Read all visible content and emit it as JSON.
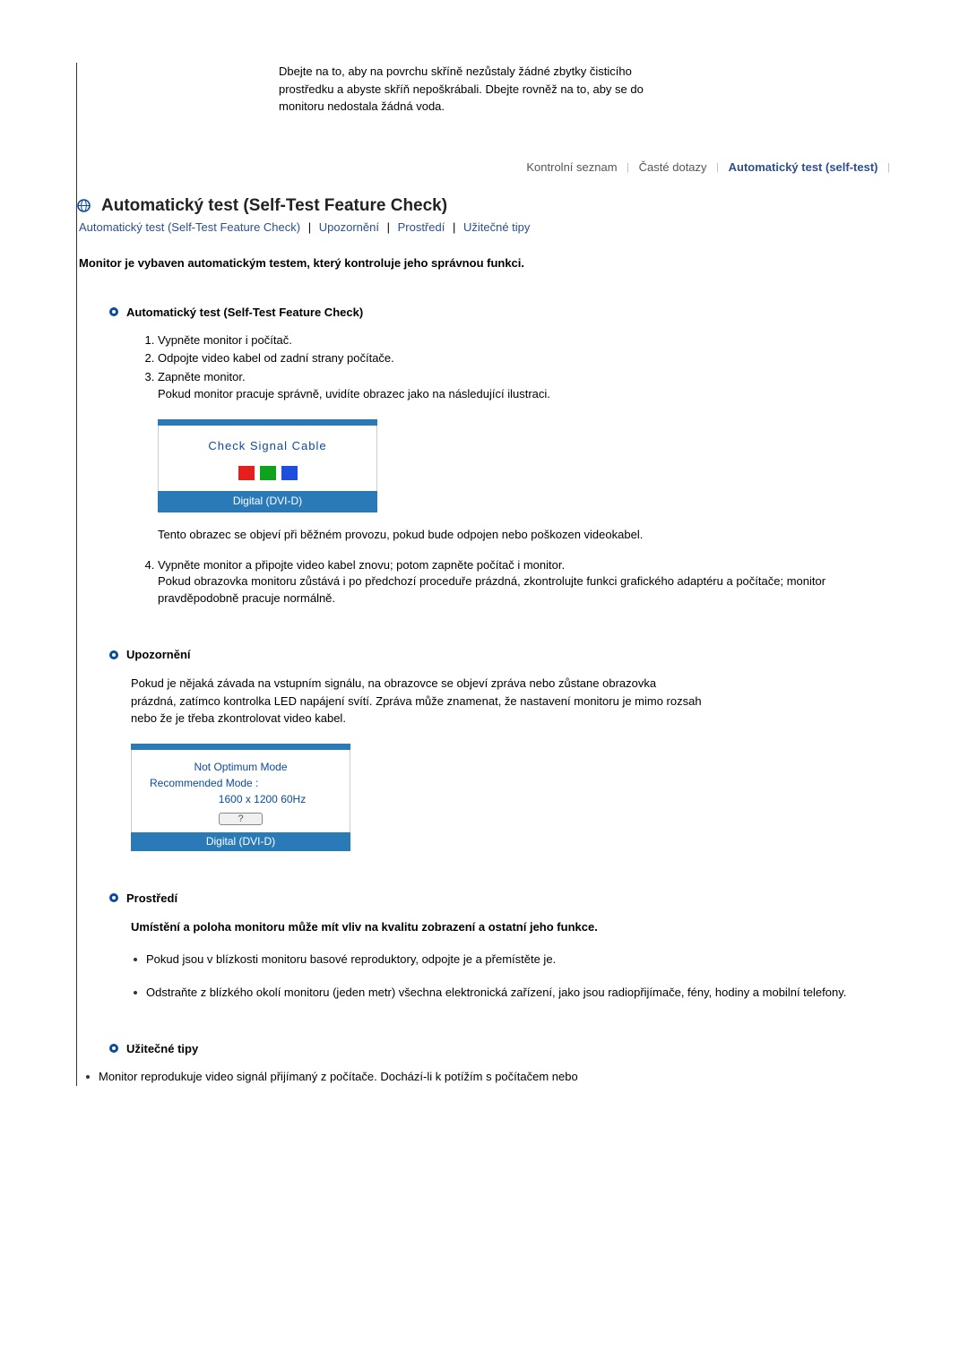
{
  "top_text": "Dbejte na to, aby na povrchu skříně nezůstaly žádné zbytky čisticího prostředku a abyste skříň nepoškrábali. Dbejte rovněž na to, aby se do monitoru nedostala žádná voda.",
  "tabs": {
    "items": [
      "Kontrolní seznam",
      "Časté dotazy",
      "Automatický test (self-test)"
    ],
    "active_index": 2
  },
  "heading": "Automatický test (Self-Test Feature Check)",
  "links": [
    "Automatický test (Self-Test Feature Check)",
    "Upozornění",
    "Prostředí",
    "Užitečné tipy"
  ],
  "intro": "Monitor je vybaven automatickým testem, který kontroluje jeho správnou funkci.",
  "section1": {
    "title": "Automatický test (Self-Test Feature Check)",
    "steps": {
      "s1": "Vypněte monitor i počítač.",
      "s2": "Odpojte video kabel od zadní strany počítače.",
      "s3a": "Zapněte monitor.",
      "s3b": "Pokud monitor pracuje správně, uvidíte obrazec jako na následující ilustraci.",
      "s4a": "Vypněte monitor a připojte video kabel znovu; potom zapněte počítač i monitor.",
      "s4b": "Pokud obrazovka monitoru zůstává i po předchozí proceduře prázdná, zkontrolujte funkci grafického adaptéru a počítače; monitor pravděpodobně pracuje normálně."
    },
    "osd": {
      "message": "Check Signal Cable",
      "footer": "Digital (DVI-D)"
    },
    "post_osd": "Tento obrazec se objeví při běžném provozu, pokud bude odpojen nebo poškozen videokabel."
  },
  "section2": {
    "title": "Upozornění",
    "text": "Pokud je nějaká závada na vstupním signálu, na obrazovce se objeví zpráva nebo zůstane obrazovka prázdná, zatímco kontrolka LED napájení svítí. Zpráva může znamenat, že nastavení monitoru je mimo rozsah nebo že je třeba zkontrolovat video kabel.",
    "osd": {
      "line1": "Not Optimum Mode",
      "line2": "Recommended Mode :",
      "line3": "1600 x 1200 60Hz",
      "btn": "?",
      "footer": "Digital (DVI-D)"
    }
  },
  "section3": {
    "title": "Prostředí",
    "bold": "Umístění a poloha monitoru může mít vliv na kvalitu zobrazení a ostatní jeho funkce.",
    "b1": "Pokud jsou v blízkosti monitoru basové reproduktory, odpojte je a přemístěte je.",
    "b2": "Odstraňte z blízkého okolí monitoru (jeden metr) všechna elektronická zařízení, jako jsou radiopřijímače, fény, hodiny a mobilní telefony."
  },
  "section4": {
    "title": "Užitečné tipy",
    "b1": "Monitor reprodukuje video signál přijímaný z počítače. Dochází-li k potížím s počítačem nebo"
  }
}
